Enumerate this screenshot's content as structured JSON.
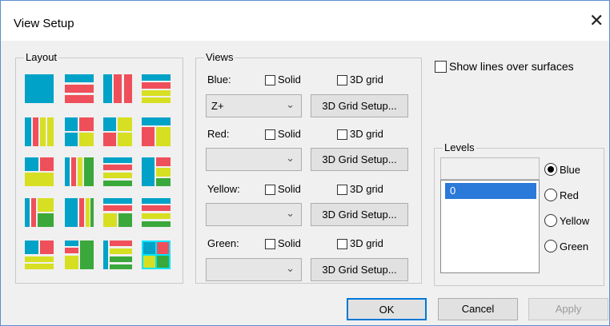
{
  "window": {
    "title": "View Setup"
  },
  "layout_group": {
    "label": "Layout"
  },
  "views_group": {
    "label": "Views",
    "rows": [
      {
        "label": "Blue:",
        "solid": "Solid",
        "grid": "3D grid",
        "combo": "Z+",
        "button": "3D Grid Setup..."
      },
      {
        "label": "Red:",
        "solid": "Solid",
        "grid": "3D grid",
        "combo": "",
        "button": "3D Grid Setup..."
      },
      {
        "label": "Yellow:",
        "solid": "Solid",
        "grid": "3D grid",
        "combo": "",
        "button": "3D Grid Setup..."
      },
      {
        "label": "Green:",
        "solid": "Solid",
        "grid": "3D grid",
        "combo": "",
        "button": "3D Grid Setup..."
      }
    ]
  },
  "show_lines": {
    "label": "Show lines over surfaces"
  },
  "levels_group": {
    "label": "Levels",
    "items": [
      "0"
    ],
    "radios": [
      "Blue",
      "Red",
      "Yellow",
      "Green"
    ],
    "selected_radio": "Blue"
  },
  "footer": {
    "ok": "OK",
    "cancel": "Cancel",
    "apply": "Apply"
  },
  "colors": {
    "blue": "#00a2c7",
    "red": "#ef4f5a",
    "yellow": "#d7df23",
    "green": "#3aa83a",
    "selection": "#2b79d8"
  },
  "icons": {
    "close": "close-icon",
    "dropdown": "chevron-down-icon"
  }
}
